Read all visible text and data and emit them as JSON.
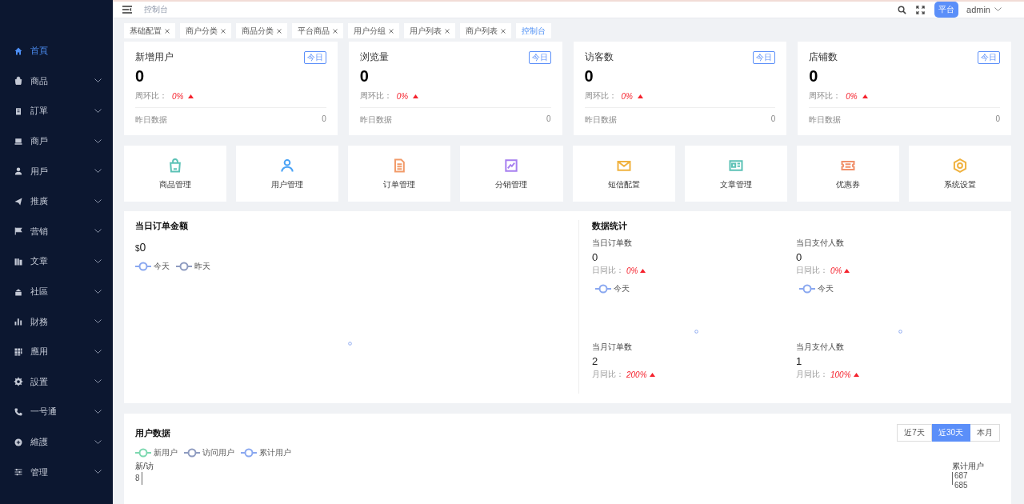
{
  "sidebar": {
    "items": [
      {
        "label": "首頁",
        "selected": true,
        "expandable": false
      },
      {
        "label": "商品",
        "selected": false,
        "expandable": true
      },
      {
        "label": "訂單",
        "selected": false,
        "expandable": true
      },
      {
        "label": "商戶",
        "selected": false,
        "expandable": true
      },
      {
        "label": "用戶",
        "selected": false,
        "expandable": true
      },
      {
        "label": "推廣",
        "selected": false,
        "expandable": true
      },
      {
        "label": "营销",
        "selected": false,
        "expandable": true
      },
      {
        "label": "文章",
        "selected": false,
        "expandable": true
      },
      {
        "label": "社區",
        "selected": false,
        "expandable": true
      },
      {
        "label": "財務",
        "selected": false,
        "expandable": true
      },
      {
        "label": "應用",
        "selected": false,
        "expandable": true
      },
      {
        "label": "設置",
        "selected": false,
        "expandable": true
      },
      {
        "label": "一号通",
        "selected": false,
        "expandable": true
      },
      {
        "label": "維護",
        "selected": false,
        "expandable": true
      },
      {
        "label": "管理",
        "selected": false,
        "expandable": true
      }
    ]
  },
  "header": {
    "breadcrumb": "控制台",
    "badge": "平台",
    "user": "admin"
  },
  "tabs": [
    {
      "label": "基础配置",
      "selected": false,
      "closable": true
    },
    {
      "label": "商户分类",
      "selected": false,
      "closable": true
    },
    {
      "label": "商品分类",
      "selected": false,
      "closable": true
    },
    {
      "label": "平台商品",
      "selected": false,
      "closable": true
    },
    {
      "label": "用户分组",
      "selected": false,
      "closable": true
    },
    {
      "label": "用户列表",
      "selected": false,
      "closable": true
    },
    {
      "label": "商户列表",
      "selected": false,
      "closable": true
    },
    {
      "label": "控制台",
      "selected": true,
      "closable": false
    }
  ],
  "stat_cards": [
    {
      "title": "新增用户",
      "badge": "今日",
      "value": "0",
      "compare_label": "周环比：",
      "compare_value": "0%",
      "footer_label": "昨日数据",
      "footer_value": "0"
    },
    {
      "title": "浏览量",
      "badge": "今日",
      "value": "0",
      "compare_label": "周环比：",
      "compare_value": "0%",
      "footer_label": "昨日数据",
      "footer_value": "0"
    },
    {
      "title": "访客数",
      "badge": "今日",
      "value": "0",
      "compare_label": "周环比：",
      "compare_value": "0%",
      "footer_label": "昨日数据",
      "footer_value": "0"
    },
    {
      "title": "店铺数",
      "badge": "今日",
      "value": "0",
      "compare_label": "周环比：",
      "compare_value": "0%",
      "footer_label": "昨日数据",
      "footer_value": "0"
    }
  ],
  "quick_links": [
    {
      "label": "商品管理",
      "color": "#5cc2b6"
    },
    {
      "label": "用户管理",
      "color": "#4ba3f5"
    },
    {
      "label": "订单管理",
      "color": "#f29b6a"
    },
    {
      "label": "分销管理",
      "color": "#a77ff0"
    },
    {
      "label": "短信配置",
      "color": "#f0b23f"
    },
    {
      "label": "文章管理",
      "color": "#5cc2b6"
    },
    {
      "label": "优惠券",
      "color": "#f0906a"
    },
    {
      "label": "系统设置",
      "color": "#f0b23f"
    }
  ],
  "order_amount": {
    "title": "当日订单金额",
    "currency": "$",
    "value": "0",
    "legend": [
      {
        "label": "今天",
        "color": "#8aa8f0"
      },
      {
        "label": "昨天",
        "color": "#8e9bc0"
      }
    ]
  },
  "data_stats": {
    "title": "数据统计",
    "items": [
      {
        "label": "当日订单数",
        "value": "0",
        "compare_label": "日同比：",
        "compare_value": "0%",
        "legend": [
          {
            "label": "今天",
            "color": "#8aa8f0"
          }
        ]
      },
      {
        "label": "当日支付人数",
        "value": "0",
        "compare_label": "日同比：",
        "compare_value": "0%",
        "legend": [
          {
            "label": "今天",
            "color": "#8aa8f0"
          }
        ]
      },
      {
        "label": "当月订单数",
        "value": "2",
        "compare_label": "月同比：",
        "compare_value": "200%"
      },
      {
        "label": "当月支付人数",
        "value": "1",
        "compare_label": "月同比：",
        "compare_value": "100%"
      }
    ]
  },
  "user_data": {
    "title": "用户数据",
    "ranges": [
      {
        "label": "近7天",
        "selected": false
      },
      {
        "label": "近30天",
        "selected": true
      },
      {
        "label": "本月",
        "selected": false
      }
    ],
    "legend": [
      {
        "label": "新用户",
        "color": "#7dd8b0"
      },
      {
        "label": "访问用户",
        "color": "#8e9bc0"
      },
      {
        "label": "累计用户",
        "color": "#8aa8f0"
      }
    ],
    "left_axis_title": "新/访",
    "left_ticks": [
      "8"
    ],
    "right_axis_title": "累计用户",
    "right_ticks": [
      "687",
      "685"
    ]
  }
}
